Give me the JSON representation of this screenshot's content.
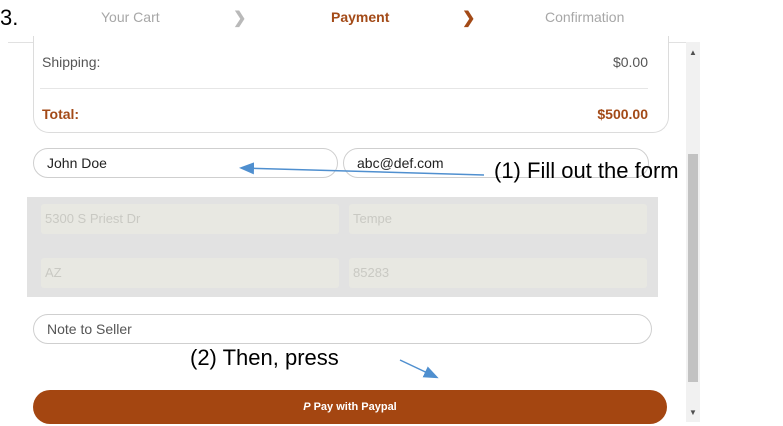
{
  "header": {
    "prefix": "3.",
    "steps": [
      {
        "label": "Your Cart"
      },
      {
        "label": "Payment"
      },
      {
        "label": "Confirmation"
      }
    ]
  },
  "summary": {
    "shipping_label": "Shipping:",
    "shipping_value": "$0.00",
    "total_label": "Total:",
    "total_value": "$500.00"
  },
  "form": {
    "name_value": "John Doe",
    "email_value": "abc@def.com",
    "address_value": "5300 S Priest Dr",
    "city_value": "Tempe",
    "state_value": "AZ",
    "zip_value": "85283",
    "note_placeholder": "Note to Seller"
  },
  "pay_button": {
    "label": "Pay with Paypal"
  },
  "annotations": {
    "step1": "(1) Fill out the form",
    "step2": "(2) Then, press"
  },
  "colors": {
    "accent": "#a34a17",
    "button": "#a44611",
    "arrow": "#4f8fcf"
  }
}
